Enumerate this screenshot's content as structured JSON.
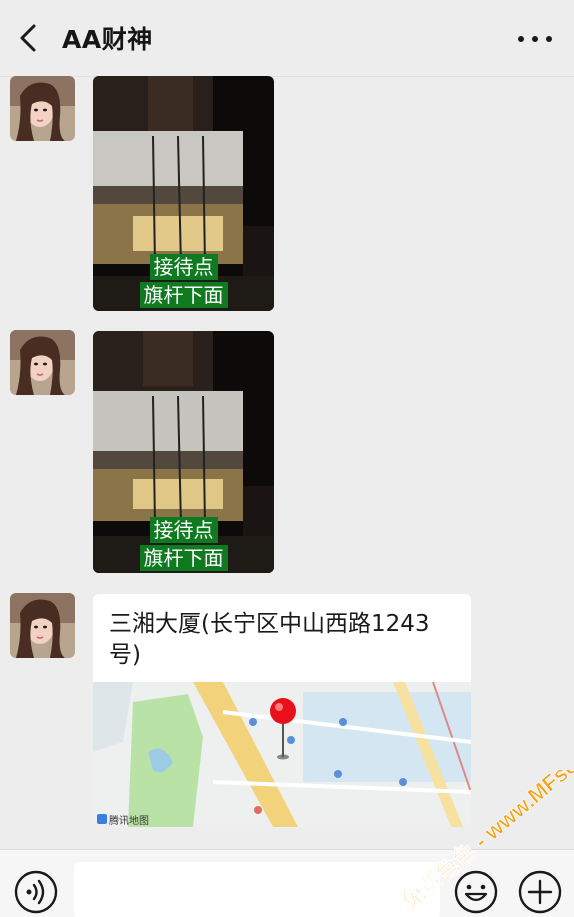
{
  "header": {
    "title": "AA财神",
    "back_icon": "chevron-left-icon",
    "more_icon": "more-dots-icon"
  },
  "messages": [
    {
      "type": "image",
      "caption_lines": [
        "接待点",
        "旗杆下面"
      ]
    },
    {
      "type": "image",
      "caption_lines": [
        "接待点",
        "旗杆下面"
      ]
    },
    {
      "type": "location",
      "title": "三湘大厦(长宁区中山西路1243号)",
      "map_attribution": "腾讯地图"
    }
  ],
  "input_bar": {
    "voice_icon": "voice-icon",
    "emoji_icon": "emoji-icon",
    "plus_icon": "plus-icon",
    "value": ""
  },
  "watermark": "免费色色 - www.MFsese.com",
  "colors": {
    "background": "#ededed",
    "caption_green": "#0f7a1f",
    "pin_red": "#e8101a"
  }
}
